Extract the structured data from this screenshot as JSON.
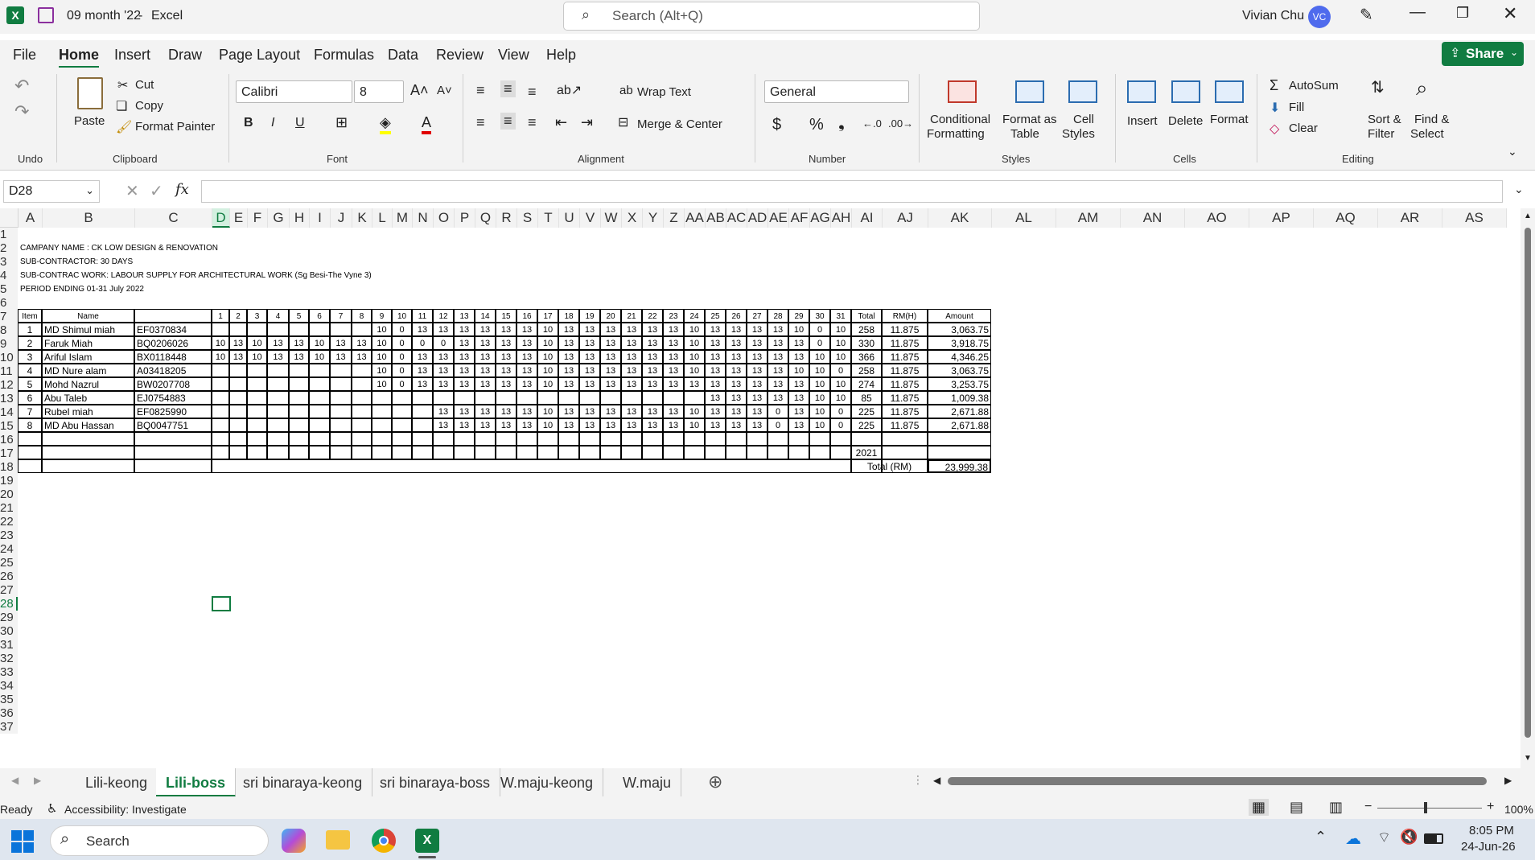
{
  "window": {
    "file_name": "09 month '22",
    "app_name": "Excel",
    "search_placeholder": "Search (Alt+Q)",
    "user_name": "Vivian Chu",
    "user_initials": "VC"
  },
  "menu": [
    "File",
    "Home",
    "Insert",
    "Draw",
    "Page Layout",
    "Formulas",
    "Data",
    "Review",
    "View",
    "Help"
  ],
  "share_label": "Share",
  "ribbon": {
    "undo_group": "Undo",
    "clipboard": {
      "paste": "Paste",
      "cut": "Cut",
      "copy": "Copy",
      "format_painter": "Format Painter",
      "group": "Clipboard"
    },
    "font": {
      "name": "Calibri",
      "size": "8",
      "group": "Font"
    },
    "alignment": {
      "wrap": "Wrap Text",
      "merge": "Merge & Center",
      "group": "Alignment"
    },
    "number": {
      "format": "General",
      "group": "Number"
    },
    "styles": {
      "conditional": "Conditional",
      "conditional2": "Formatting",
      "format_table": "Format as",
      "format_table2": "Table",
      "cell_styles": "Cell",
      "cell_styles2": "Styles",
      "group": "Styles"
    },
    "cells": {
      "insert": "Insert",
      "delete": "Delete",
      "format": "Format",
      "group": "Cells"
    },
    "editing": {
      "autosum": "AutoSum",
      "fill": "Fill",
      "clear": "Clear",
      "sort": "Sort &",
      "sort2": "Filter",
      "find": "Find &",
      "find2": "Select",
      "group": "Editing"
    }
  },
  "formula_bar": {
    "name_box": "D28",
    "formula": ""
  },
  "columns": [
    "A",
    "B",
    "C",
    "D",
    "E",
    "F",
    "G",
    "H",
    "I",
    "J",
    "K",
    "L",
    "M",
    "N",
    "O",
    "P",
    "Q",
    "R",
    "S",
    "T",
    "U",
    "V",
    "W",
    "X",
    "Y",
    "Z",
    "AA",
    "AB",
    "AC",
    "AD",
    "AE",
    "AF",
    "AG",
    "AH",
    "AI",
    "AJ",
    "AK",
    "AL",
    "AM",
    "AN",
    "AO",
    "AP",
    "AQ",
    "AR",
    "AS"
  ],
  "rows": [
    "1",
    "2",
    "3",
    "4",
    "5",
    "6",
    "7",
    "8",
    "9",
    "10",
    "11",
    "12",
    "13",
    "14",
    "15",
    "16",
    "17",
    "18",
    "19",
    "20",
    "21",
    "22",
    "23",
    "24",
    "25",
    "26",
    "27",
    "28",
    "29",
    "30",
    "31",
    "32",
    "33",
    "34",
    "35",
    "36",
    "37"
  ],
  "header_info": [
    "CAMPANY NAME : CK LOW DESIGN & RENOVATION",
    "SUB-CONTRACTOR: 30 DAYS",
    "SUB-CONTRAC WORK: LABOUR SUPPLY FOR ARCHITECTURAL WORK (Sg Besi-The Vyne 3)",
    "PERIOD ENDING 01-31 July 2022"
  ],
  "table_headers": {
    "item": "Item",
    "name": "Name",
    "days": [
      "1",
      "2",
      "3",
      "4",
      "5",
      "6",
      "7",
      "8",
      "9",
      "10",
      "11",
      "12",
      "13",
      "14",
      "15",
      "16",
      "17",
      "18",
      "19",
      "20",
      "21",
      "22",
      "23",
      "24",
      "25",
      "26",
      "27",
      "28",
      "29",
      "30",
      "31"
    ],
    "total": "Total",
    "rate": "RM(H)",
    "amount": "Amount"
  },
  "table_rows": [
    {
      "item": "1",
      "name": "MD Shimul miah",
      "id": "EF0370834",
      "days": [
        "",
        "",
        "",
        "",
        "",
        "",
        "",
        "",
        "10",
        "0",
        "13",
        "13",
        "13",
        "13",
        "13",
        "13",
        "10",
        "13",
        "13",
        "13",
        "13",
        "13",
        "13",
        "10",
        "13",
        "13",
        "13",
        "13",
        "10",
        "0",
        "10"
      ],
      "total": "258",
      "rate": "11.875",
      "amount": "3,063.75"
    },
    {
      "item": "2",
      "name": "Faruk Miah",
      "id": "BQ0206026",
      "days": [
        "10",
        "13",
        "10",
        "13",
        "13",
        "10",
        "13",
        "13",
        "10",
        "0",
        "0",
        "0",
        "13",
        "13",
        "13",
        "13",
        "10",
        "13",
        "13",
        "13",
        "13",
        "13",
        "13",
        "10",
        "13",
        "13",
        "13",
        "13",
        "13",
        "0",
        "10"
      ],
      "total": "330",
      "rate": "11.875",
      "amount": "3,918.75"
    },
    {
      "item": "3",
      "name": "Ariful Islam",
      "id": "BX0118448",
      "days": [
        "10",
        "13",
        "10",
        "13",
        "13",
        "10",
        "13",
        "13",
        "10",
        "0",
        "13",
        "13",
        "13",
        "13",
        "13",
        "13",
        "10",
        "13",
        "13",
        "13",
        "13",
        "13",
        "13",
        "10",
        "13",
        "13",
        "13",
        "13",
        "13",
        "10",
        "10"
      ],
      "total": "366",
      "rate": "11.875",
      "amount": "4,346.25"
    },
    {
      "item": "4",
      "name": "MD Nure alam",
      "id": "A03418205",
      "days": [
        "",
        "",
        "",
        "",
        "",
        "",
        "",
        "",
        "10",
        "0",
        "13",
        "13",
        "13",
        "13",
        "13",
        "13",
        "10",
        "13",
        "13",
        "13",
        "13",
        "13",
        "13",
        "10",
        "13",
        "13",
        "13",
        "13",
        "10",
        "10",
        "0"
      ],
      "total": "258",
      "rate": "11.875",
      "amount": "3,063.75"
    },
    {
      "item": "5",
      "name": "Mohd Nazrul",
      "id": "BW0207708",
      "days": [
        "",
        "",
        "",
        "",
        "",
        "",
        "",
        "",
        "10",
        "0",
        "13",
        "13",
        "13",
        "13",
        "13",
        "13",
        "10",
        "13",
        "13",
        "13",
        "13",
        "13",
        "13",
        "13",
        "13",
        "13",
        "13",
        "13",
        "13",
        "10",
        "10"
      ],
      "total": "274",
      "rate": "11.875",
      "amount": "3,253.75"
    },
    {
      "item": "6",
      "name": "Abu Taleb",
      "id": "EJ0754883",
      "days": [
        "",
        "",
        "",
        "",
        "",
        "",
        "",
        "",
        "",
        "",
        "",
        "",
        "",
        "",
        "",
        "",
        "",
        "",
        "",
        "",
        "",
        "",
        "",
        "",
        "13",
        "13",
        "13",
        "13",
        "13",
        "10",
        "10"
      ],
      "total": "85",
      "rate": "11.875",
      "amount": "1,009.38"
    },
    {
      "item": "7",
      "name": "Rubel miah",
      "id": "EF0825990",
      "days": [
        "",
        "",
        "",
        "",
        "",
        "",
        "",
        "",
        "",
        "",
        "",
        "13",
        "13",
        "13",
        "13",
        "13",
        "10",
        "13",
        "13",
        "13",
        "13",
        "13",
        "13",
        "10",
        "13",
        "13",
        "13",
        "0",
        "13",
        "10",
        "0"
      ],
      "total": "225",
      "rate": "11.875",
      "amount": "2,671.88"
    },
    {
      "item": "8",
      "name": "MD Abu Hassan",
      "id": "BQ0047751",
      "days": [
        "",
        "",
        "",
        "",
        "",
        "",
        "",
        "",
        "",
        "",
        "",
        "13",
        "13",
        "13",
        "13",
        "13",
        "10",
        "13",
        "13",
        "13",
        "13",
        "13",
        "13",
        "10",
        "13",
        "13",
        "13",
        "0",
        "13",
        "10",
        "0"
      ],
      "total": "225",
      "rate": "11.875",
      "amount": "2,671.88"
    }
  ],
  "year_cell": "2021",
  "total_label": "Total (RM)",
  "grand_total": "23,999.38",
  "sheet_tabs": [
    "Lili-keong",
    "Lili-boss",
    "sri binaraya-keong",
    "sri binaraya-boss",
    "W.maju-keong",
    "W.maju"
  ],
  "active_tab": "Lili-boss",
  "status": {
    "ready": "Ready",
    "accessibility": "Accessibility: Investigate",
    "zoom": "100%"
  },
  "taskbar": {
    "search": "Search",
    "time": "8:05 PM",
    "date": "24-Jun-26"
  }
}
